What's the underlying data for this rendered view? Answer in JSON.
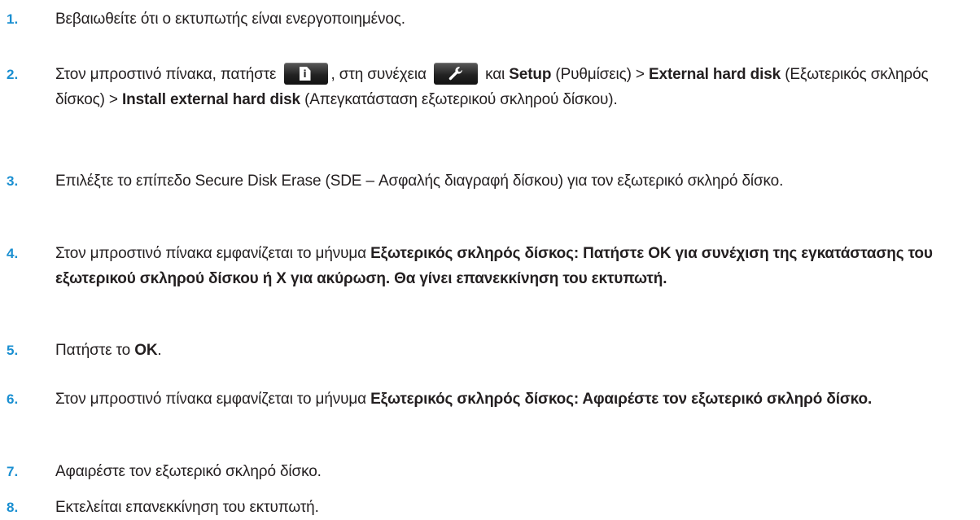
{
  "steps": [
    {
      "num": "1.",
      "text": "Βεβαιωθείτε ότι ο εκτυπωτής είναι ενεργοποιημένος."
    },
    {
      "num": "2.",
      "p1": "Στον μπροστινό πίνακα, πατήστε",
      "p2": ", στη συνέχεια",
      "p3": "και",
      "b1": "Setup",
      "p4": "(Ρυθμίσεις) >",
      "b2": "External hard disk",
      "p5": "(Εξωτερικός σκληρός δίσκος) >",
      "b3": "Install external hard disk",
      "p6": "(Απεγκατάσταση εξωτερικού σκληρού δίσκου).",
      "icon1": "info-icon",
      "icon2": "wrench-icon"
    },
    {
      "num": "3.",
      "text": "Επιλέξτε το επίπεδο Secure Disk Erase (SDE – Ασφαλής διαγραφή δίσκου) για τον εξωτερικό σκληρό δίσκο."
    },
    {
      "num": "4.",
      "p1": "Στον μπροστινό πίνακα εμφανίζεται το μήνυμα",
      "b1": "Εξωτερικός σκληρός δίσκος: Πατήστε OK για συνέχιση της εγκατάστασης του εξωτερικού σκληρού δίσκου ή X για ακύρωση. Θα γίνει επανεκκίνηση του εκτυπωτή."
    },
    {
      "num": "5.",
      "p1": "Πατήστε το",
      "b1": "OK",
      "p2": "."
    },
    {
      "num": "6.",
      "p1": "Στον μπροστινό πίνακα εμφανίζεται το μήνυμα",
      "b1": "Εξωτερικός σκληρός δίσκος: Αφαιρέστε τον εξωτερικό σκληρό δίσκο."
    },
    {
      "num": "7.",
      "text": "Αφαιρέστε τον εξωτερικό σκληρό δίσκο."
    },
    {
      "num": "8.",
      "text": "Εκτελείται επανεκκίνηση του εκτυπωτή."
    }
  ],
  "colors": {
    "step_number": "#1a8fd1",
    "text": "#231f20",
    "button_icon_background": "#232323"
  }
}
